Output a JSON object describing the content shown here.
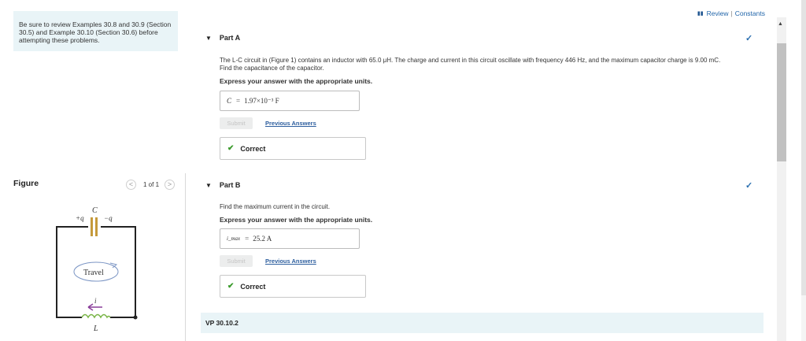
{
  "hint": {
    "text": "Be sure to review Examples 30.8 and 30.9 (Section 30.5) and Example 30.10 (Section 30.6) before attempting these problems."
  },
  "figure": {
    "label": "Figure",
    "pager": {
      "prev": "<",
      "count": "1 of 1",
      "next": ">"
    },
    "circuit": {
      "cap_label": "C",
      "plus_label": "+q",
      "minus_label": "−q",
      "travel_label": "Travel",
      "current_label": "i",
      "inductor_label": "L"
    }
  },
  "top_links": {
    "review": "Review",
    "separator": "|",
    "constants": "Constants"
  },
  "part_a": {
    "title": "Part A",
    "question_line1": "The L-C circuit in (Figure 1) contains an inductor with 65.0 μH. The charge and current in this circuit oscillate with frequency 446 Hz, and the maximum capacitor charge is 9.00 mC.",
    "question_line2": "Find the capacitance of the capacitor.",
    "instruction": "Express your answer with the appropriate units.",
    "answer_var": "C",
    "answer_eq": "=",
    "answer_value": "1.97×10⁻³ F",
    "submit_label": "Submit",
    "previous_answers_label": "Previous Answers",
    "status": "Correct"
  },
  "part_b": {
    "title": "Part B",
    "question_line1": "Find the maximum current in the circuit.",
    "instruction": "Express your answer with the appropriate units.",
    "answer_var": "i_max",
    "answer_eq": "=",
    "answer_value": "25.2 A",
    "submit_label": "Submit",
    "previous_answers_label": "Previous Answers",
    "status": "Correct"
  },
  "next_section": {
    "title": "VP 30.10.2"
  },
  "icons": {
    "collapse": "triangle-down",
    "check": "checkmark",
    "correct": "checkmark-green",
    "review": "review-icon"
  },
  "colors": {
    "accent": "#2a6fb0",
    "correct": "#3a9a2b",
    "panel": "#e9f4f7"
  }
}
